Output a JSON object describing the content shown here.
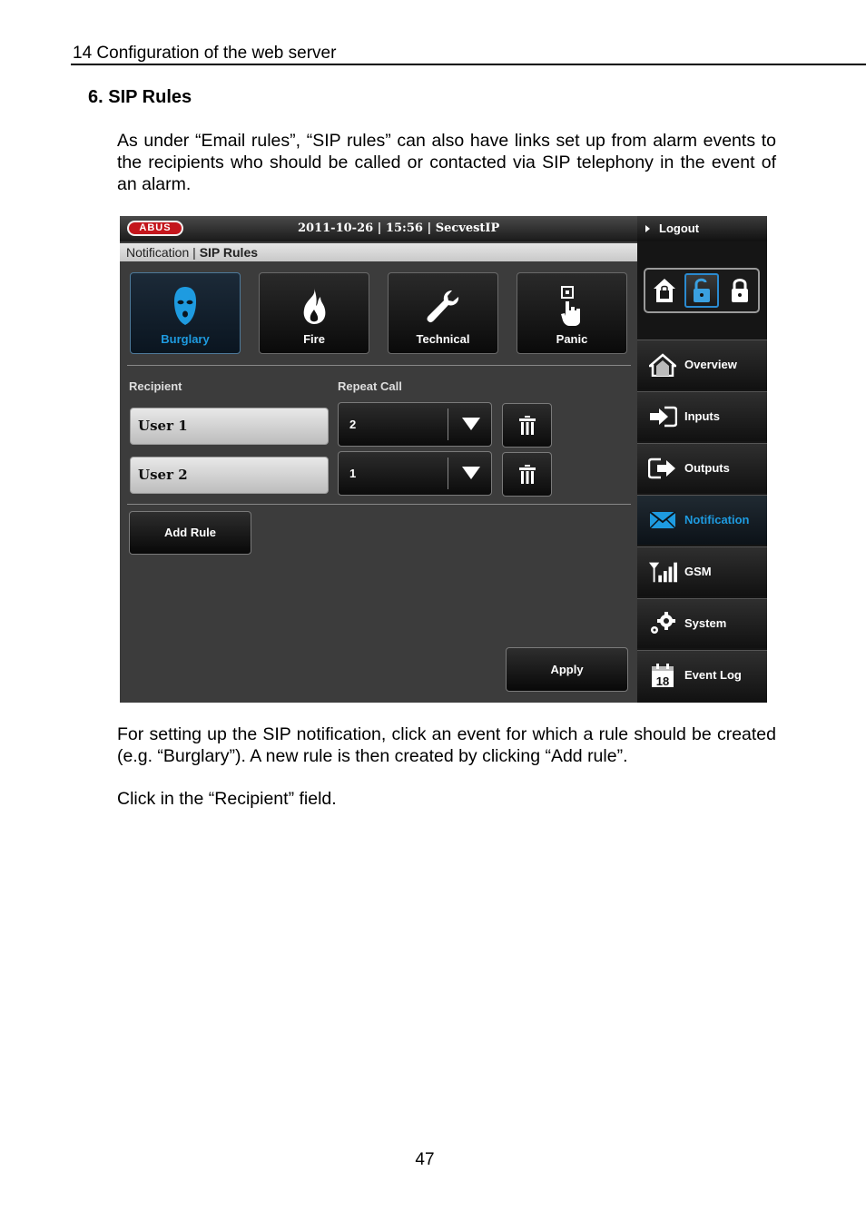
{
  "doc": {
    "header": "14  Configuration of the web server",
    "section": "6.   SIP Rules",
    "para1": "As under “Email rules”, “SIP rules” can also have links set up from alarm events to the recipients who should be called or contacted via SIP telephony in the event of an alarm.",
    "para2": "For setting up the SIP notification, click an event for which a rule should be created (e.g. “Burglary”). A new rule is then created by clicking “Add rule”.",
    "para3": "Click in the “Recipient” field.",
    "page_number": "47"
  },
  "ui": {
    "logo": "ABUS",
    "datetime": "2011-10-26  |  15:56  |  SecvestIP",
    "breadcrumb": {
      "parent": "Notification",
      "sep": " | ",
      "current": "SIP Rules"
    },
    "events": [
      {
        "label": "Burglary",
        "icon": "mask-icon",
        "active": true
      },
      {
        "label": "Fire",
        "icon": "flame-icon",
        "active": false
      },
      {
        "label": "Technical",
        "icon": "wrench-icon",
        "active": false
      },
      {
        "label": "Panic",
        "icon": "panic-button-icon",
        "active": false
      }
    ],
    "columns": {
      "recipient": "Recipient",
      "repeat": "Repeat Call"
    },
    "rules": [
      {
        "recipient": "User 1",
        "repeat": "2"
      },
      {
        "recipient": "User 2",
        "repeat": "1"
      }
    ],
    "add_rule": "Add Rule",
    "apply": "Apply",
    "logout": "Logout",
    "nav": [
      {
        "label": "Overview",
        "icon": "home-icon"
      },
      {
        "label": "Inputs",
        "icon": "input-icon"
      },
      {
        "label": "Outputs",
        "icon": "output-icon"
      },
      {
        "label": "Notification",
        "icon": "envelope-icon",
        "active": true
      },
      {
        "label": "GSM",
        "icon": "signal-icon"
      },
      {
        "label": "System",
        "icon": "gears-icon"
      },
      {
        "label": "Event Log",
        "icon": "calendar-icon",
        "badge": "18"
      }
    ],
    "colors": {
      "accent": "#1e9be0",
      "brand": "#c4161c"
    }
  }
}
